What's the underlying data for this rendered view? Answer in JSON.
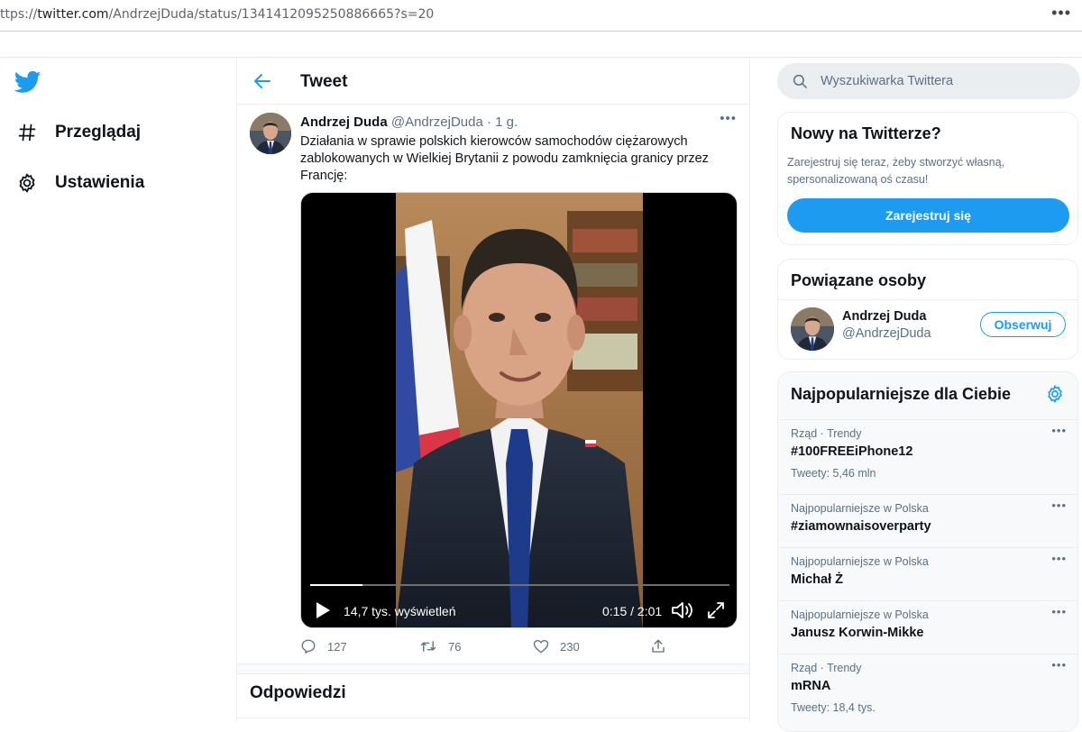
{
  "browser": {
    "url_prefix": "ttps://",
    "url_domain": "twitter.com",
    "url_path": "/AndrzejDuda/status/1341412095250886665?s=20",
    "menu_glyph": "•••"
  },
  "nav": {
    "logo_icon": "twitter-bird-icon",
    "items": [
      {
        "label": "Przeglądaj",
        "icon": "hashtag-icon"
      },
      {
        "label": "Ustawienia",
        "icon": "gear-icon"
      }
    ]
  },
  "header": {
    "title": "Tweet"
  },
  "tweet": {
    "name": "Andrzej Duda",
    "handle": "@AndrzejDuda",
    "time": " · 1 g.",
    "more": "•••",
    "text": "Działania w sprawie polskich kierowców samochodów ciężarowych zablokowanych w Wielkiej Brytanii z powodu zamknięcia granicy przez Francję:",
    "video": {
      "views": "14,7 tys. wyświetleń",
      "time": "0:15 / 2:01",
      "progress_fraction": 0.124
    },
    "stats": {
      "replies": "127",
      "retweets": "76",
      "likes": "230"
    }
  },
  "replies_header": "Odpowiedzi",
  "search": {
    "placeholder": "Wyszukiwarka Twittera"
  },
  "new_on_twitter": {
    "title": "Nowy na Twitterze?",
    "subtitle": "Zarejestruj się teraz, żeby stworzyć własną, spersonalizowaną oś czasu!",
    "button": "Zarejestruj się"
  },
  "related": {
    "title": "Powiązane osoby",
    "person": {
      "name": "Andrzej Duda",
      "handle": "@AndrzejDuda",
      "button": "Obserwuj"
    }
  },
  "trends": {
    "title": "Najpopularniejsze dla Ciebie",
    "items": [
      {
        "context": "Rząd · Trendy",
        "title": "#100FREEiPhone12",
        "count": "Tweety: 5,46 mln"
      },
      {
        "context": "Najpopularniejsze w Polska",
        "title": "#ziamownaisoverparty",
        "count": ""
      },
      {
        "context": "Najpopularniejsze w Polska",
        "title": "Michał Ż",
        "count": ""
      },
      {
        "context": "Najpopularniejsze w Polska",
        "title": "Janusz Korwin-Mikke",
        "count": ""
      },
      {
        "context": "Rząd · Trendy",
        "title": "mRNA",
        "count": "Tweety: 18,4 tys."
      }
    ]
  },
  "colors": {
    "accent": "#1d9bf0",
    "muted": "#5b7083"
  }
}
